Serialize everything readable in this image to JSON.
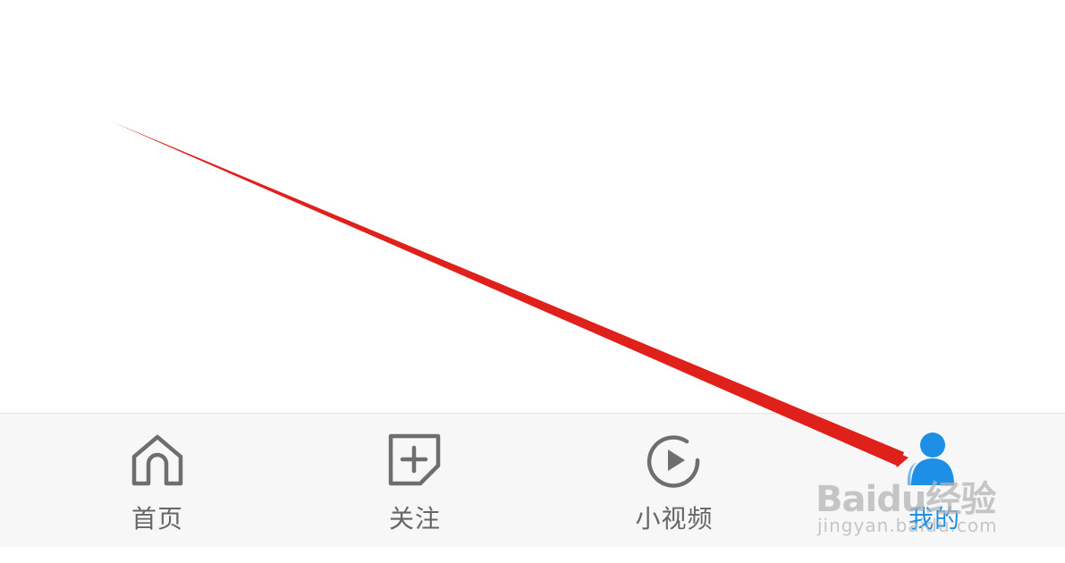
{
  "tabbar": {
    "tabs": [
      {
        "label": "首页",
        "icon": "home-icon",
        "active": false
      },
      {
        "label": "关注",
        "icon": "follow-add-icon",
        "active": false
      },
      {
        "label": "小视频",
        "icon": "play-circle-icon",
        "active": false
      },
      {
        "label": "我的",
        "icon": "user-profile-icon",
        "active": true
      }
    ]
  },
  "watermark": {
    "brand": "Baidu经验",
    "sub": "jingyan.baidu.com"
  },
  "colors": {
    "active": "#1e8fe6",
    "inactive": "#666666",
    "icon_gray": "#6e6e6e",
    "arrow": "#e0201b",
    "tabbar_bg": "#f7f7f7"
  }
}
